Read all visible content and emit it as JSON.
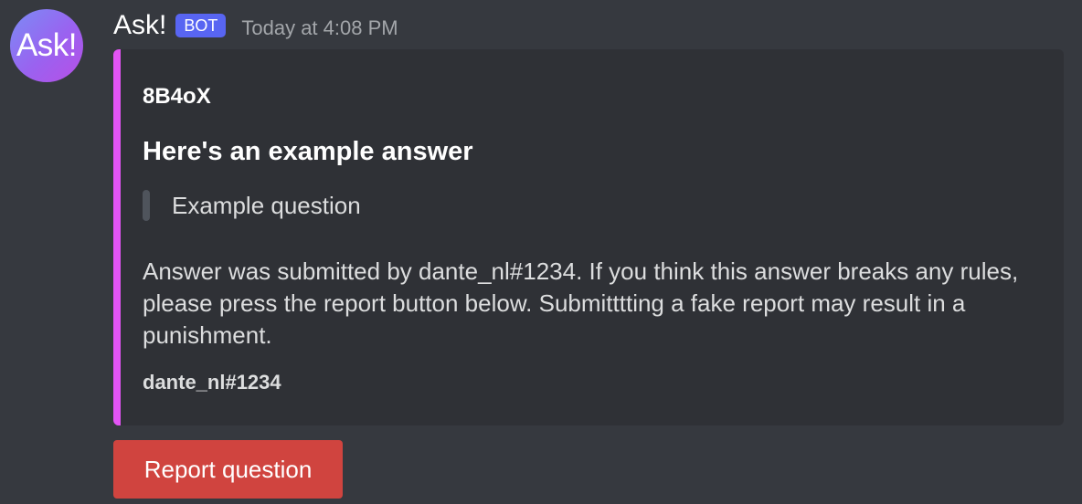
{
  "message": {
    "avatar_text": "Ask!",
    "username": "Ask!",
    "badge": "BOT",
    "timestamp": "Today at 4:08 PM"
  },
  "embed": {
    "accent_color": "#e354f5",
    "author": "8B4oX",
    "title": "Here's an example answer",
    "quote": "Example question",
    "description": "Answer was submitted by dante_nl#1234. If you think this answer breaks any rules, please press the report button below. Submitttting a fake report may result in a punishment.",
    "footer": "dante_nl#1234"
  },
  "actions": {
    "report_label": "Report question",
    "report_color": "#d0443f"
  },
  "colors": {
    "background": "#36393f",
    "embed_background": "#2f3136",
    "badge": "#5865f2"
  }
}
